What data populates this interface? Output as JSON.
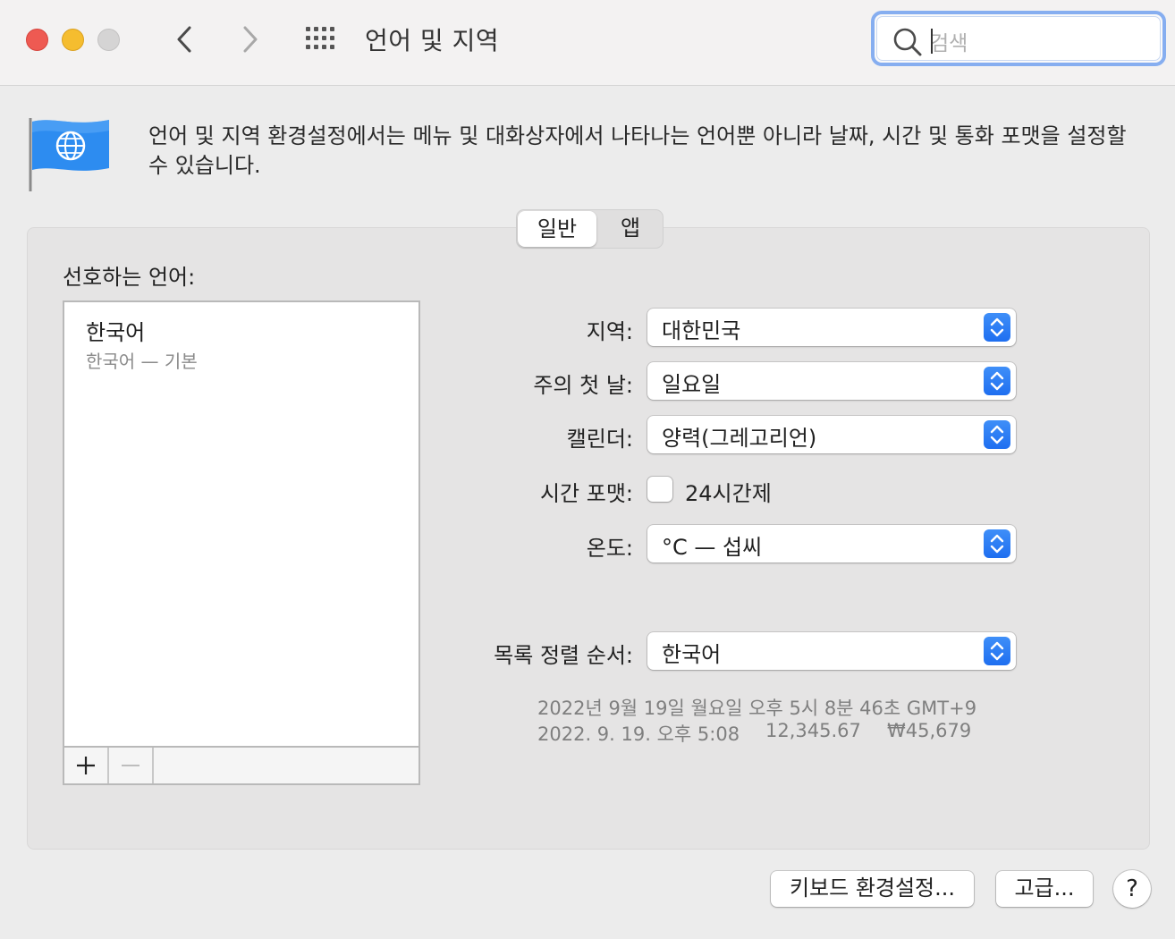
{
  "window": {
    "title": "언어 및 지역",
    "search_placeholder": "검색"
  },
  "header": {
    "description": "언어 및 지역 환경설정에서는 메뉴 및 대화상자에서 나타나는 언어뿐 아니라 날짜, 시간 및 통화 포맷을 설정할 수 있습니다."
  },
  "tabs": [
    {
      "label": "일반",
      "selected": true
    },
    {
      "label": "앱",
      "selected": false
    }
  ],
  "preferred_languages": {
    "label": "선호하는 언어:",
    "items": [
      {
        "name": "한국어",
        "subtitle": "한국어 — 기본"
      }
    ],
    "add_label": "+",
    "remove_label": "—"
  },
  "settings": {
    "region": {
      "label": "지역:",
      "value": "대한민국"
    },
    "first_day": {
      "label": "주의 첫 날:",
      "value": "일요일"
    },
    "calendar": {
      "label": "캘린더:",
      "value": "양력(그레고리언)"
    },
    "time_format": {
      "label": "시간 포맷:",
      "checkbox_label": "24시간제",
      "checked": false
    },
    "temperature": {
      "label": "온도:",
      "value": "°C — 섭씨"
    },
    "list_sort": {
      "label": "목록 정렬 순서:",
      "value": "한국어"
    }
  },
  "samples": {
    "line1": "2022년 9월 19일 월요일 오후 5시 8분 46초 GMT+9",
    "date": "2022. 9. 19. 오후 5:08",
    "number": "12,345.67",
    "currency": "₩45,679"
  },
  "buttons": {
    "keyboard": "키보드 환경설정...",
    "advanced": "고급...",
    "help": "?"
  },
  "colors": {
    "accent": "#1f6ff0",
    "close": "#ee5a52",
    "minimize": "#f5bd2f",
    "zoom_inactive": "#d5d4d4",
    "flag": "#2d8cf0"
  }
}
